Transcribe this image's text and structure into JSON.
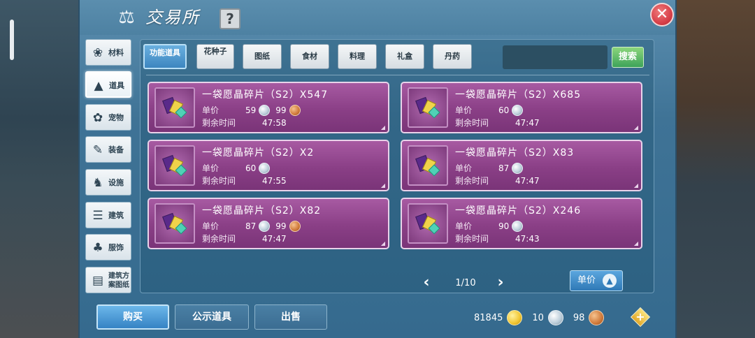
{
  "header": {
    "title": "交易所",
    "title_icon": "scales-icon",
    "help_label": "?",
    "close_label": "✕"
  },
  "sidebar": {
    "items": [
      {
        "label": "材料",
        "icon": "materials-icon",
        "glyph": "❀",
        "active": false
      },
      {
        "label": "道具",
        "icon": "tool-icon",
        "glyph": "▲",
        "active": true
      },
      {
        "label": "宠物",
        "icon": "pet-paw-icon",
        "glyph": "✿",
        "active": false
      },
      {
        "label": "装备",
        "icon": "equipment-icon",
        "glyph": "✎",
        "active": false
      },
      {
        "label": "设施",
        "icon": "facility-icon",
        "glyph": "♞",
        "active": false
      },
      {
        "label": "建筑",
        "icon": "building-icon",
        "glyph": "☰",
        "active": false
      },
      {
        "label": "服饰",
        "icon": "clothing-icon",
        "glyph": "♣",
        "active": false
      },
      {
        "label": "建筑方案图纸",
        "icon": "blueprint-icon",
        "glyph": "▤",
        "active": false
      }
    ]
  },
  "tabs": [
    {
      "label": "功能道具",
      "active": true
    },
    {
      "label": "花种子",
      "active": false
    },
    {
      "label": "图纸",
      "active": false
    },
    {
      "label": "食材",
      "active": false
    },
    {
      "label": "料理",
      "active": false
    },
    {
      "label": "礼盒",
      "active": false
    },
    {
      "label": "丹药",
      "active": false
    }
  ],
  "search": {
    "value": "",
    "placeholder": "",
    "button_label": "搜索"
  },
  "listing_labels": {
    "price_label": "单价",
    "time_label": "剩余时间"
  },
  "listings": [
    {
      "name": "一袋愿晶碎片（S2）X547",
      "silver": "59",
      "copper": "99",
      "time": "47:58"
    },
    {
      "name": "一袋愿晶碎片（S2）X685",
      "silver": "60",
      "copper": "",
      "time": "47:47"
    },
    {
      "name": "一袋愿晶碎片（S2）X2",
      "silver": "60",
      "copper": "",
      "time": "47:55"
    },
    {
      "name": "一袋愿晶碎片（S2）X83",
      "silver": "87",
      "copper": "",
      "time": "47:47"
    },
    {
      "name": "一袋愿晶碎片（S2）X82",
      "silver": "87",
      "copper": "99",
      "time": "47:47"
    },
    {
      "name": "一袋愿晶碎片（S2）X246",
      "silver": "90",
      "copper": "",
      "time": "47:43"
    }
  ],
  "pager": {
    "text": "1/10",
    "prev": "‹",
    "next": "›"
  },
  "sort": {
    "label": "单价"
  },
  "actions": {
    "buy": "购买",
    "public_items": "公示道具",
    "sell": "出售"
  },
  "wallet": {
    "gold": "81845",
    "silver": "10",
    "copper": "98",
    "add_label": "+"
  },
  "colors": {
    "card": "#8a3f86",
    "accent_blue": "#3d86c0",
    "search_green": "#3ea35a",
    "close_red": "#d8414a"
  }
}
